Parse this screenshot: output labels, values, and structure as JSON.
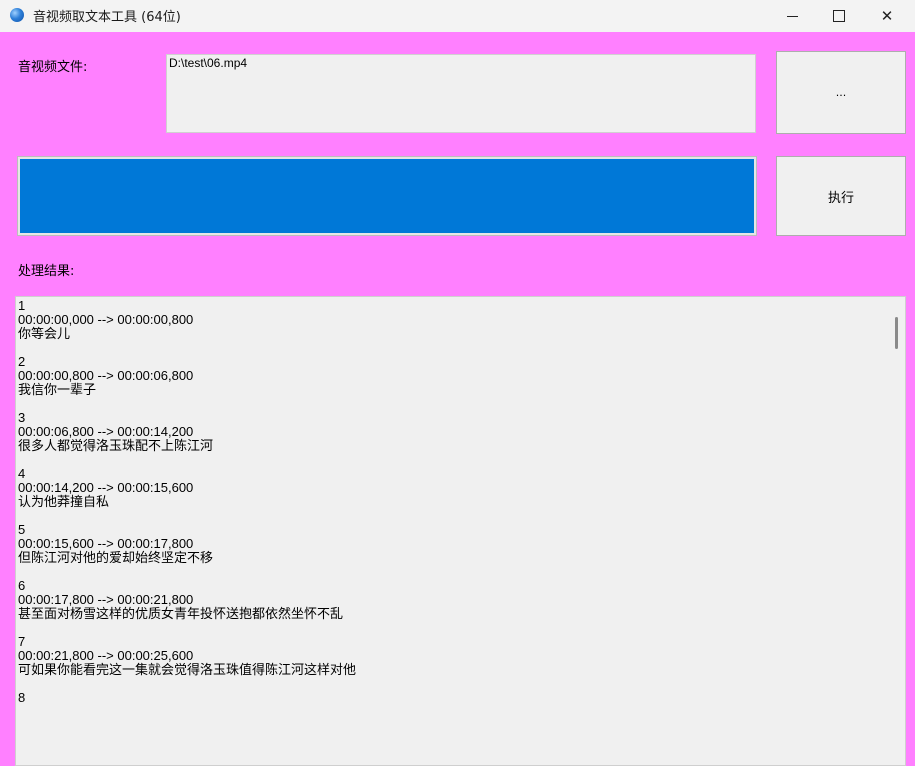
{
  "window": {
    "title": "音视频取文本工具 (64位)",
    "close_glyph": "✕"
  },
  "form": {
    "file_label": "音视频文件:",
    "file_path": "D:\\test\\06.mp4",
    "browse_label": "...",
    "execute_label": "执行",
    "progress": 1.0,
    "result_label": "处理结果:"
  },
  "results": [
    {
      "index": "1",
      "time": "00:00:00,000 --> 00:00:00,800",
      "text": "你等会儿"
    },
    {
      "index": "2",
      "time": "00:00:00,800 --> 00:00:06,800",
      "text": "我信你一辈子"
    },
    {
      "index": "3",
      "time": "00:00:06,800 --> 00:00:14,200",
      "text": "很多人都觉得洛玉珠配不上陈江河"
    },
    {
      "index": "4",
      "time": "00:00:14,200 --> 00:00:15,600",
      "text": "认为他莽撞自私"
    },
    {
      "index": "5",
      "time": "00:00:15,600 --> 00:00:17,800",
      "text": "但陈江河对他的爱却始终坚定不移"
    },
    {
      "index": "6",
      "time": "00:00:17,800 --> 00:00:21,800",
      "text": "甚至面对杨雪这样的优质女青年投怀送抱都依然坐怀不乱"
    },
    {
      "index": "7",
      "time": "00:00:21,800 --> 00:00:25,600",
      "text": "可如果你能看完这一集就会觉得洛玉珠值得陈江河这样对他"
    },
    {
      "index": "8",
      "time": "",
      "text": ""
    }
  ]
}
